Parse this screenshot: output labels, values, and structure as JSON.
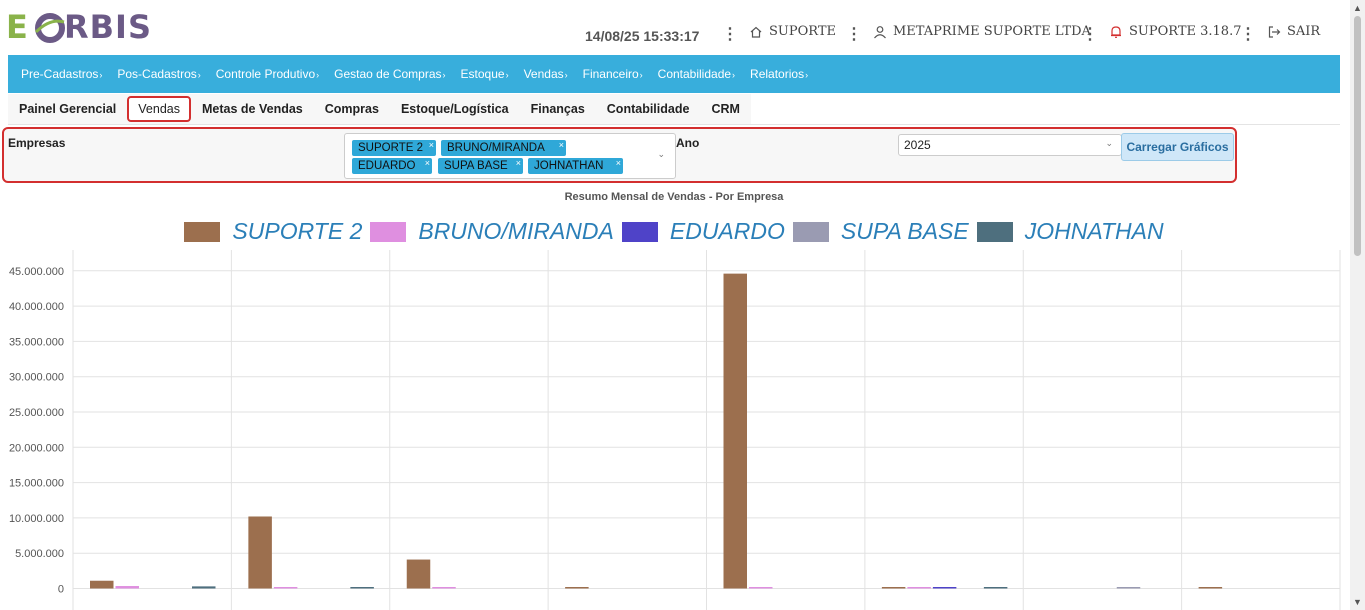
{
  "header": {
    "logo_text_e": "E",
    "logo_text_rest": "RBIS",
    "datetime": "14/08/25 15:33:17",
    "support_link": "SUPORTE",
    "company": "METAPRIME SUPORTE LTDA",
    "version": "SUPORTE 3.18.7",
    "logout": "SAIR",
    "separator": "⋮"
  },
  "menu": [
    {
      "label": "Pre-Cadastros"
    },
    {
      "label": "Pos-Cadastros"
    },
    {
      "label": "Controle Produtivo"
    },
    {
      "label": "Gestao de Compras"
    },
    {
      "label": "Estoque"
    },
    {
      "label": "Vendas"
    },
    {
      "label": "Financeiro"
    },
    {
      "label": "Contabilidade"
    },
    {
      "label": "Relatorios"
    }
  ],
  "menu_chevron": "›",
  "tabs": [
    {
      "label": "Painel Gerencial"
    },
    {
      "label": "Vendas"
    },
    {
      "label": "Metas de Vendas"
    },
    {
      "label": "Compras"
    },
    {
      "label": "Estoque/Logística"
    },
    {
      "label": "Finanças"
    },
    {
      "label": "Contabilidade"
    },
    {
      "label": "CRM"
    }
  ],
  "active_tab": "Vendas",
  "filters": {
    "companies_label": "Empresas",
    "year_label": "Ano",
    "selected_companies": [
      "SUPORTE 2",
      "BRUNO/MIRANDA",
      "EDUARDO",
      "SUPA BASE",
      "JOHNATHAN"
    ],
    "chip_remove": "×",
    "dropdown_caret": "⌄",
    "year_value": "2025",
    "load_button": "Carregar Gráficos"
  },
  "colors": {
    "accent": "#38aedc",
    "highlight_border": "#d32f2f"
  },
  "chart_data": {
    "type": "bar",
    "title": "Resumo Mensal de Vendas - Por Empresa",
    "legend_position": "top",
    "grid": true,
    "ylim": [
      0,
      47500000
    ],
    "y_ticks": [
      "0",
      "5.000.000",
      "10.000.000",
      "15.000.000",
      "20.000.000",
      "25.000.000",
      "30.000.000",
      "35.000.000",
      "40.000.000",
      "45.000.000"
    ],
    "categories_visible": 8,
    "series": [
      {
        "name": "SUPORTE 2",
        "color": "#9c6f4e",
        "values": [
          1100000,
          10200000,
          4100000,
          200000,
          44600000,
          50000,
          0,
          200000
        ]
      },
      {
        "name": "BRUNO/MIRANDA",
        "color": "#df8fe0",
        "values": [
          350000,
          200000,
          50000,
          0,
          50000,
          50000,
          0,
          0
        ]
      },
      {
        "name": "EDUARDO",
        "color": "#4f43c8",
        "values": [
          0,
          0,
          0,
          0,
          0,
          50000,
          0,
          0
        ]
      },
      {
        "name": "SUPA BASE",
        "color": "#9a9bb2",
        "values": [
          0,
          0,
          0,
          0,
          0,
          0,
          50000,
          0
        ]
      },
      {
        "name": "JOHNATHAN",
        "color": "#4e6f7e",
        "values": [
          300000,
          200000,
          0,
          0,
          0,
          50000,
          0,
          0
        ]
      }
    ]
  }
}
